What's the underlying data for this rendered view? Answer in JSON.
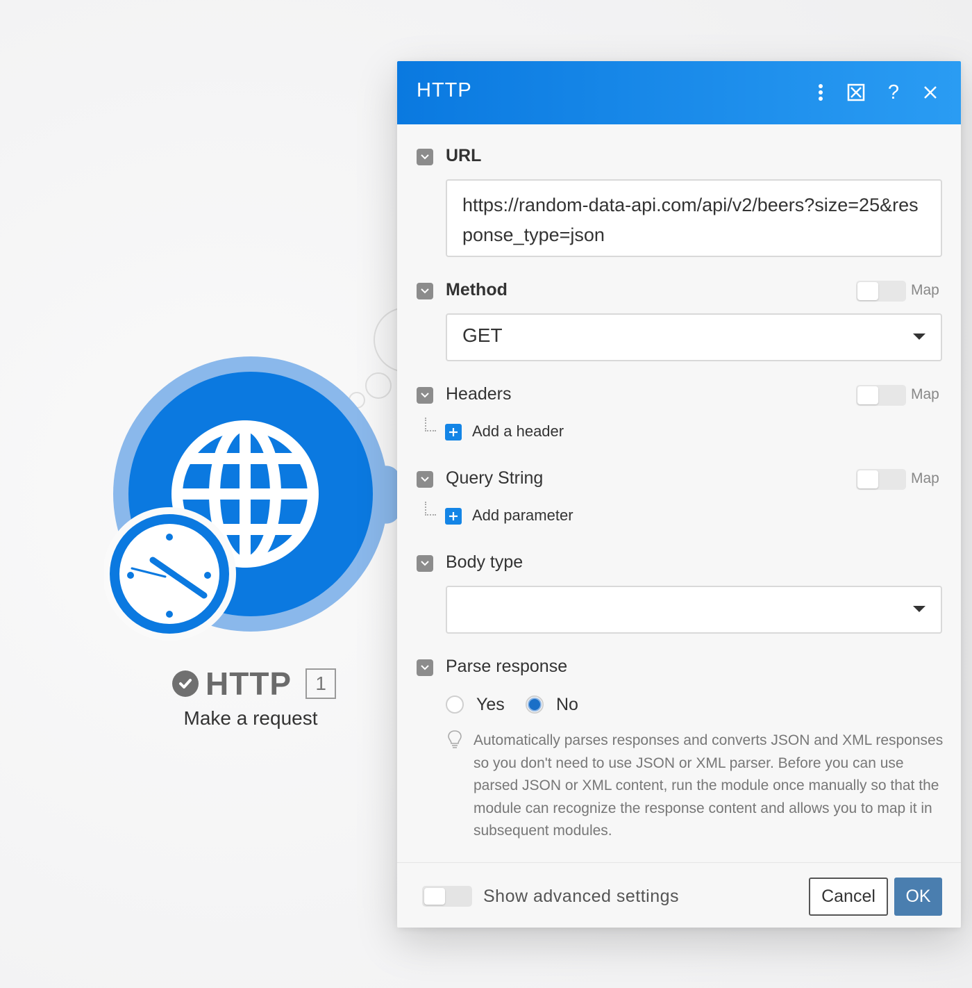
{
  "module": {
    "name": "HTTP",
    "id": "1",
    "action": "Make a request",
    "colors": {
      "primary": "#0b79e0",
      "halo": "#8ab8eb"
    }
  },
  "dialog": {
    "title": "HTTP",
    "header_icons": [
      "more-vertical-icon",
      "expand-icon",
      "help-icon",
      "close-icon"
    ],
    "url": {
      "label": "URL",
      "value": "https://random-data-api.com/api/v2/beers?size=25&response_type=json"
    },
    "method": {
      "label": "Method",
      "map_label": "Map",
      "value": "GET"
    },
    "headers": {
      "label": "Headers",
      "map_label": "Map",
      "add_label": "Add a header"
    },
    "query_string": {
      "label": "Query String",
      "map_label": "Map",
      "add_label": "Add parameter"
    },
    "body_type": {
      "label": "Body type",
      "value": ""
    },
    "parse_response": {
      "label": "Parse response",
      "options": [
        "Yes",
        "No"
      ],
      "selected": "No",
      "help": "Automatically parses responses and converts JSON and XML responses so you don't need to use JSON or XML parser. Before you can use parsed JSON or XML content, run the module once manually so that the module can recognize the response content and allows you to map it in subsequent modules."
    },
    "footer": {
      "advanced_label": "Show advanced settings",
      "cancel_label": "Cancel",
      "ok_label": "OK"
    }
  }
}
